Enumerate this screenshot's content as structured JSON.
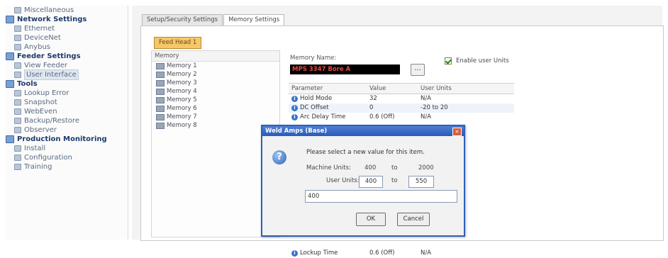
{
  "sidebar": {
    "items": [
      {
        "label": "Miscellaneous",
        "level": "child"
      },
      {
        "label": "Network Settings",
        "level": "header"
      },
      {
        "label": "Ethernet",
        "level": "child"
      },
      {
        "label": "DeviceNet",
        "level": "child"
      },
      {
        "label": "Anybus",
        "level": "child"
      },
      {
        "label": "Feeder Settings",
        "level": "header"
      },
      {
        "label": "View Feeder",
        "level": "child"
      },
      {
        "label": "User Interface",
        "level": "child",
        "selected": true
      },
      {
        "label": "Tools",
        "level": "header"
      },
      {
        "label": "Lookup Error",
        "level": "child"
      },
      {
        "label": "Snapshot",
        "level": "child"
      },
      {
        "label": "WebEven",
        "level": "child"
      },
      {
        "label": "Backup/Restore",
        "level": "child"
      },
      {
        "label": "Observer",
        "level": "child"
      },
      {
        "label": "Production Monitoring",
        "level": "header"
      },
      {
        "label": "Install",
        "level": "child"
      },
      {
        "label": "Configuration",
        "level": "child"
      },
      {
        "label": "Training",
        "level": "child"
      }
    ]
  },
  "tabs": [
    {
      "label": "Setup/Security Settings",
      "active": false
    },
    {
      "label": "Memory Settings",
      "active": true
    }
  ],
  "feed_head_button": "Feed Head 1",
  "memory_list": {
    "header": "Memory",
    "items": [
      "Memory 1",
      "Memory 2",
      "Memory 3",
      "Memory 4",
      "Memory 5",
      "Memory 6",
      "Memory 7",
      "Memory 8"
    ]
  },
  "memory_name": {
    "label": "Memory Name:",
    "value": "MPS 3347 Bore A",
    "browse_label": "..."
  },
  "enable_user_units": {
    "label": "Enable user Units",
    "checked": true
  },
  "param_table": {
    "headers": [
      "Parameter",
      "Value",
      "User Units"
    ],
    "rows": [
      {
        "param": "Hold Mode",
        "value": "32",
        "units": "N/A"
      },
      {
        "param": "DC Offset",
        "value": "0",
        "units": "-20 to 20"
      },
      {
        "param": "Arc Delay Time",
        "value": "0.6 (Off)",
        "units": "N/A"
      }
    ],
    "last_row": {
      "param": "Lockup Time",
      "value": "0.6 (Off)",
      "units": "N/A"
    }
  },
  "dialog": {
    "title": "Weld Amps (Base)",
    "message": "Please select a new value for this item.",
    "machine_units_label": "Machine Units:",
    "machine_min": "400",
    "to1": "to",
    "machine_max": "2000",
    "user_units_label": "User Units:",
    "user_min": "400",
    "to2": "to",
    "user_max": "550",
    "input_value": "400",
    "ok_label": "OK",
    "cancel_label": "Cancel"
  },
  "colors": {
    "dialog_title": "#2b5ab4",
    "feed_head": "#f6c76a",
    "memory_name_text": "#e84a3a"
  }
}
